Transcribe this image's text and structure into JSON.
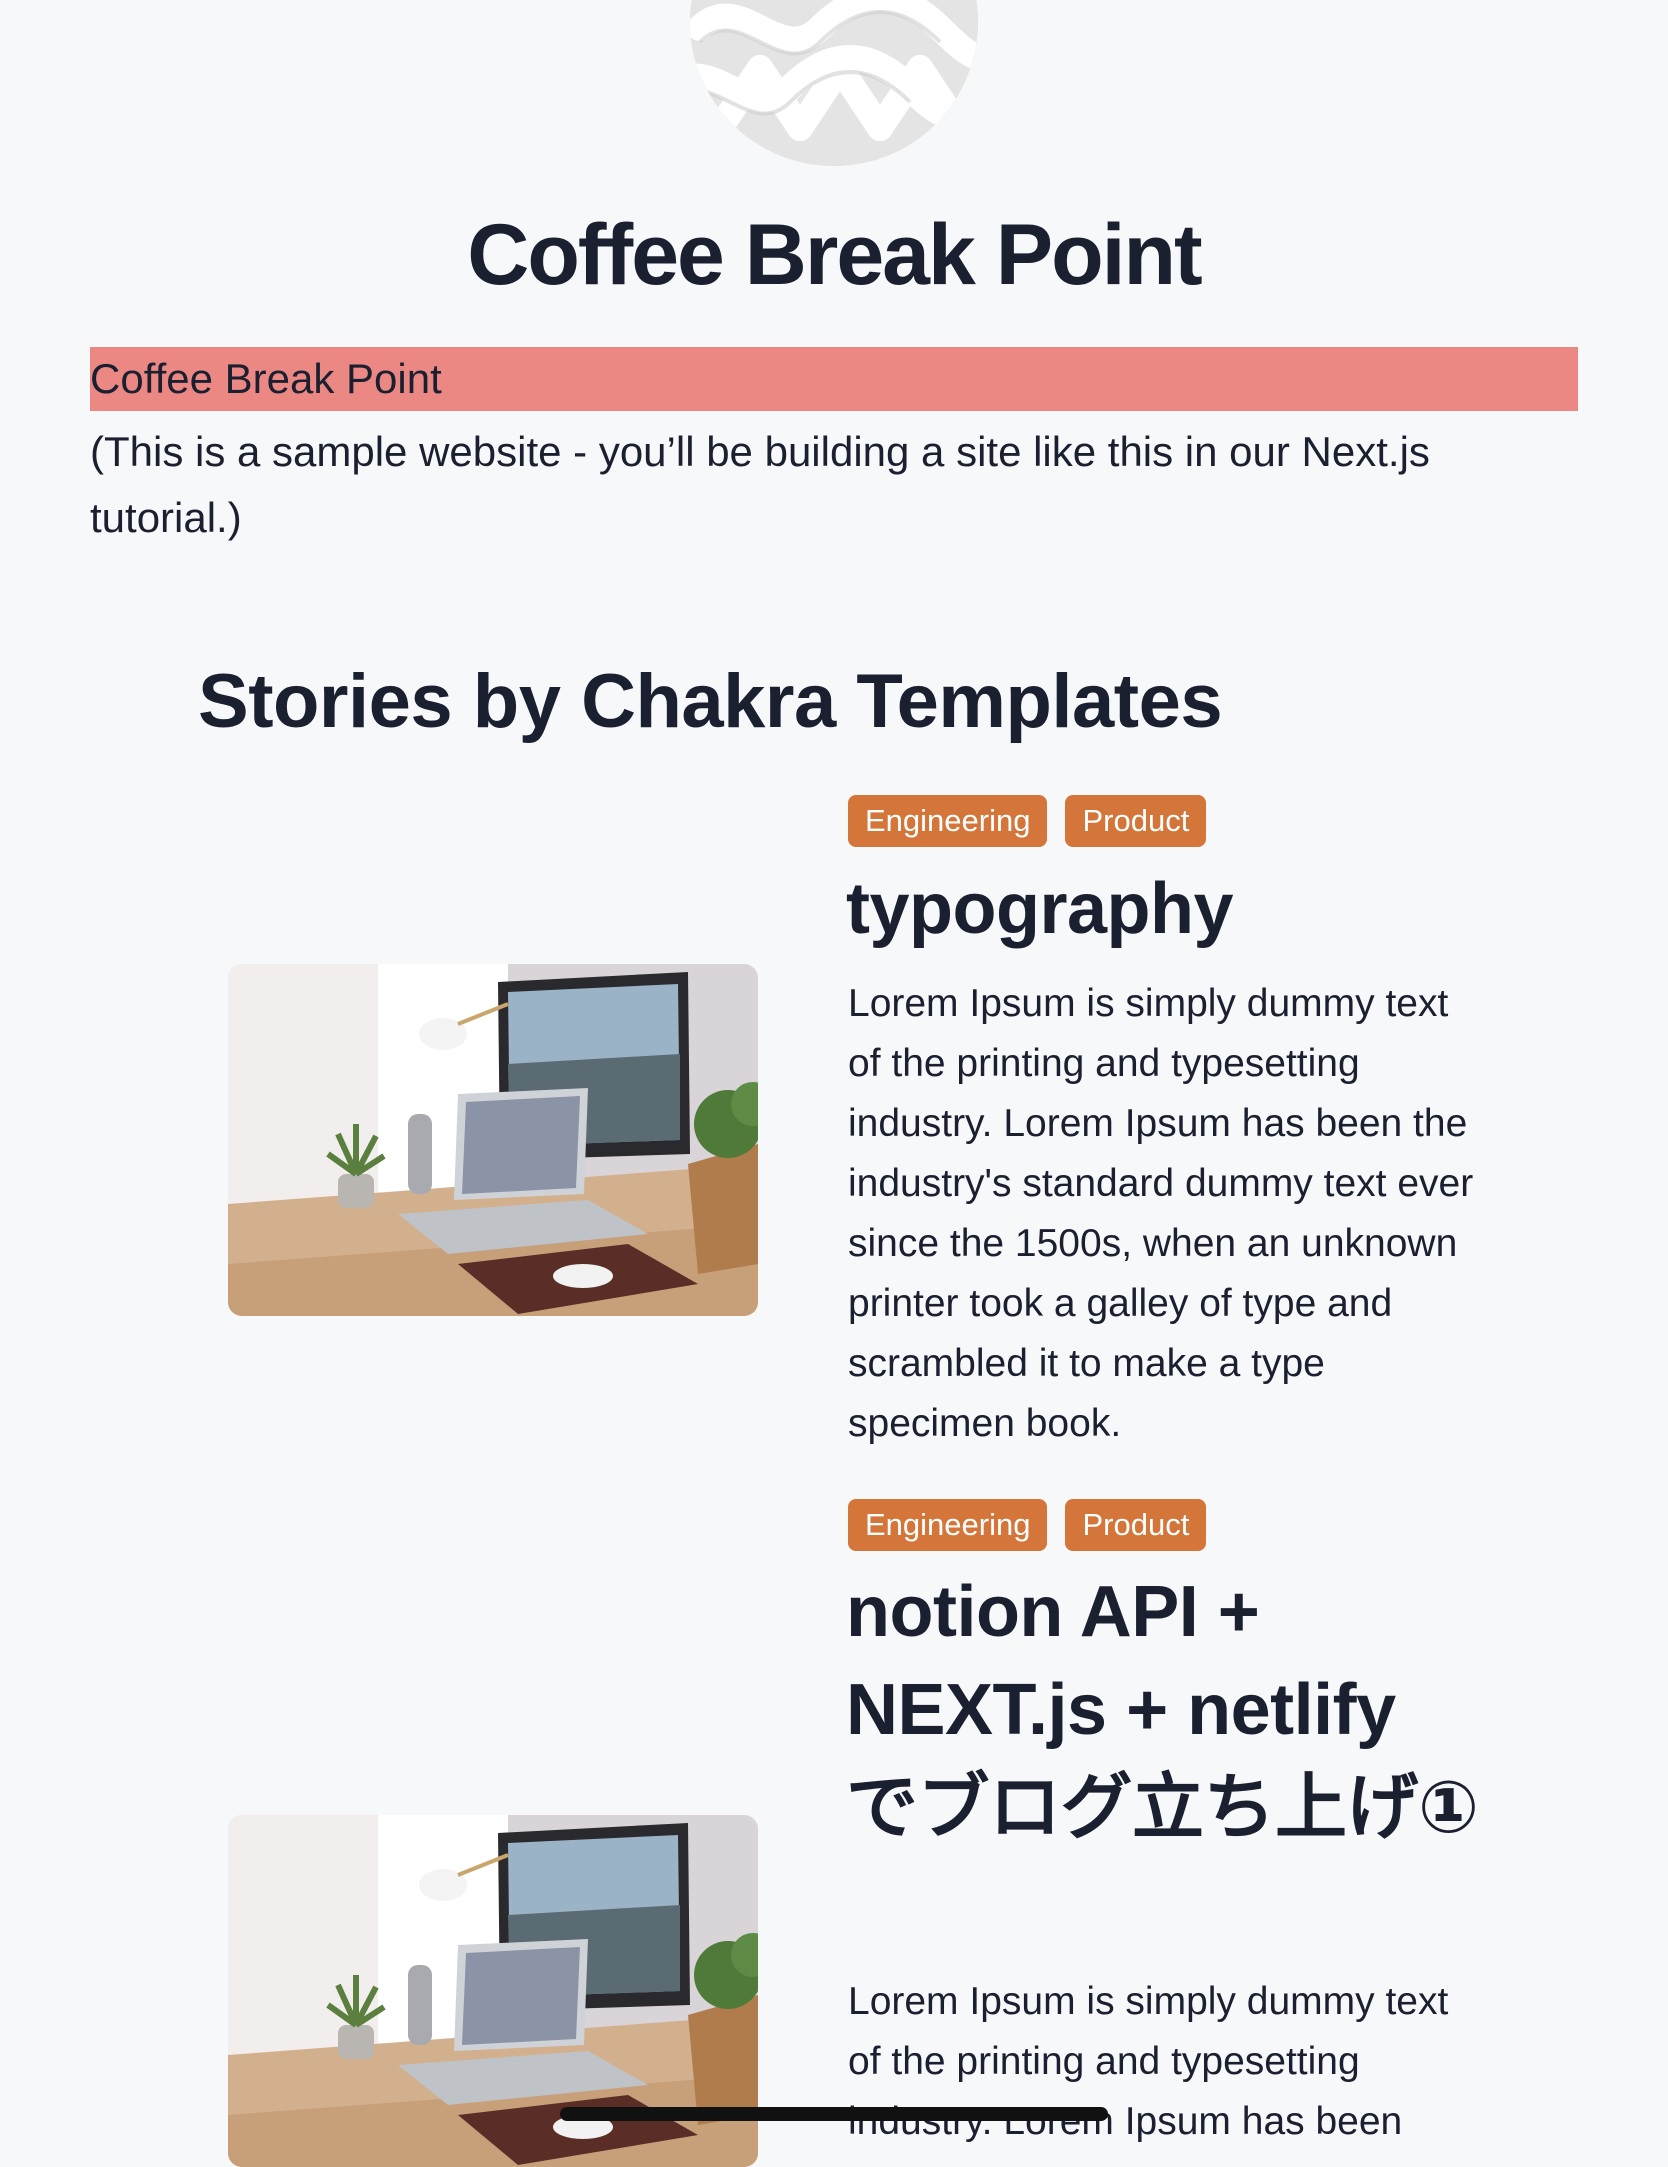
{
  "header": {
    "site_title": "Coffee Break Point",
    "highlight_text": "Coffee Break Point",
    "intro_text": "(This is a sample website - you’ll be building a site like this in our Next.js tutorial.)"
  },
  "section": {
    "heading": "Stories by Chakra Templates"
  },
  "stories": [
    {
      "tags": [
        "Engineering",
        "Product"
      ],
      "title": "typography",
      "body": "Lorem Ipsum is simply dummy text of the printing and typesetting industry. Lorem Ipsum has been the industry's standard dummy text ever since the 1500s, when an unknown printer took a galley of type and scrambled it to make a type specimen book."
    },
    {
      "tags": [
        "Engineering",
        "Product"
      ],
      "title": "notion API + NEXT.js + netlify でブログ立ち上げ①",
      "body": "Lorem Ipsum is simply dummy text of the printing and typesetting industry. Lorem Ipsum has been"
    }
  ],
  "colors": {
    "background": "#f7f8fa",
    "highlight": "#ec8884",
    "tag": "#d4753a",
    "text": "#1b2030"
  },
  "icons": {
    "avatar": "woven-pattern-avatar",
    "story_image": "desk-workspace-photo"
  }
}
